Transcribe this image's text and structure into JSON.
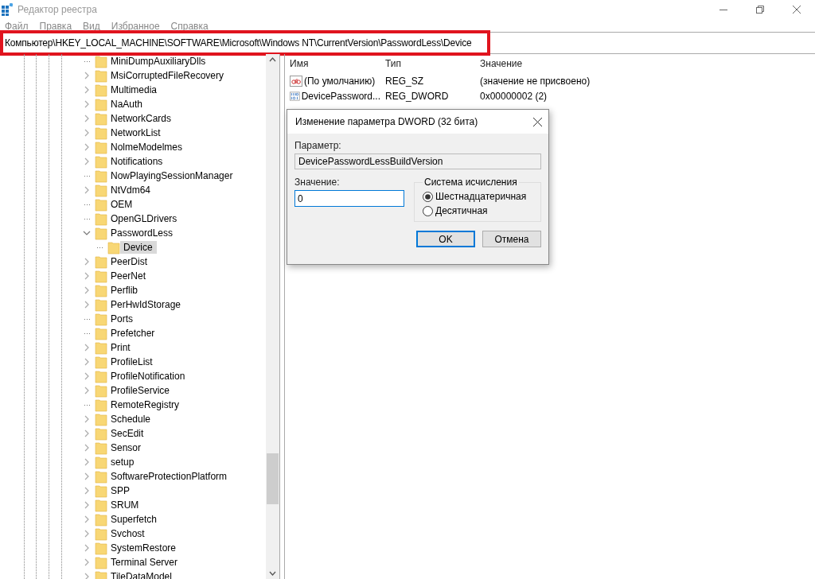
{
  "window": {
    "title": "Редактор реестра"
  },
  "menu": [
    "Файл",
    "Правка",
    "Вид",
    "Избранное",
    "Справка"
  ],
  "address_bar": {
    "value": "Компьютер\\HKEY_LOCAL_MACHINE\\SOFTWARE\\Microsoft\\Windows NT\\CurrentVersion\\PasswordLess\\Device",
    "highlighted": true
  },
  "tree": {
    "items": [
      {
        "label": "MiniDumpAuxiliaryDlls",
        "kind": "leaf",
        "selected": false
      },
      {
        "label": "MsiCorruptedFileRecovery",
        "kind": "folder",
        "expanded": false,
        "selected": false
      },
      {
        "label": "Multimedia",
        "kind": "folder",
        "expanded": false,
        "selected": false
      },
      {
        "label": "NaAuth",
        "kind": "folder",
        "expanded": false,
        "selected": false
      },
      {
        "label": "NetworkCards",
        "kind": "folder",
        "expanded": false,
        "selected": false
      },
      {
        "label": "NetworkList",
        "kind": "folder",
        "expanded": false,
        "selected": false
      },
      {
        "label": "NolmeModelmes",
        "kind": "folder",
        "expanded": false,
        "selected": false
      },
      {
        "label": "Notifications",
        "kind": "folder",
        "expanded": false,
        "selected": false
      },
      {
        "label": "NowPlayingSessionManager",
        "kind": "leaf",
        "selected": false
      },
      {
        "label": "NtVdm64",
        "kind": "folder",
        "expanded": false,
        "selected": false
      },
      {
        "label": "OEM",
        "kind": "leaf",
        "selected": false
      },
      {
        "label": "OpenGLDrivers",
        "kind": "leaf",
        "selected": false
      },
      {
        "label": "PasswordLess",
        "kind": "folder",
        "expanded": true,
        "selected": false,
        "children": [
          {
            "label": "Device",
            "kind": "leaf",
            "selected": true
          }
        ]
      },
      {
        "label": "PeerDist",
        "kind": "folder",
        "expanded": false,
        "selected": false
      },
      {
        "label": "PeerNet",
        "kind": "folder",
        "expanded": false,
        "selected": false
      },
      {
        "label": "Perflib",
        "kind": "folder",
        "expanded": false,
        "selected": false
      },
      {
        "label": "PerHwIdStorage",
        "kind": "folder",
        "expanded": false,
        "selected": false
      },
      {
        "label": "Ports",
        "kind": "leaf",
        "selected": false
      },
      {
        "label": "Prefetcher",
        "kind": "leaf",
        "selected": false
      },
      {
        "label": "Print",
        "kind": "folder",
        "expanded": false,
        "selected": false
      },
      {
        "label": "ProfileList",
        "kind": "folder",
        "expanded": false,
        "selected": false
      },
      {
        "label": "ProfileNotification",
        "kind": "folder",
        "expanded": false,
        "selected": false
      },
      {
        "label": "ProfileService",
        "kind": "folder",
        "expanded": false,
        "selected": false
      },
      {
        "label": "RemoteRegistry",
        "kind": "leaf",
        "selected": false
      },
      {
        "label": "Schedule",
        "kind": "folder",
        "expanded": false,
        "selected": false
      },
      {
        "label": "SecEdit",
        "kind": "folder",
        "expanded": false,
        "selected": false
      },
      {
        "label": "Sensor",
        "kind": "folder",
        "expanded": false,
        "selected": false
      },
      {
        "label": "setup",
        "kind": "folder",
        "expanded": false,
        "selected": false
      },
      {
        "label": "SoftwareProtectionPlatform",
        "kind": "folder",
        "expanded": false,
        "selected": false
      },
      {
        "label": "SPP",
        "kind": "folder",
        "expanded": false,
        "selected": false
      },
      {
        "label": "SRUM",
        "kind": "folder",
        "expanded": false,
        "selected": false
      },
      {
        "label": "Superfetch",
        "kind": "folder",
        "expanded": false,
        "selected": false
      },
      {
        "label": "Svchost",
        "kind": "folder",
        "expanded": false,
        "selected": false
      },
      {
        "label": "SystemRestore",
        "kind": "folder",
        "expanded": false,
        "selected": false
      },
      {
        "label": "Terminal Server",
        "kind": "folder",
        "expanded": false,
        "selected": false
      },
      {
        "label": "TileDataModel",
        "kind": "folder",
        "expanded": false,
        "selected": false
      }
    ]
  },
  "values": {
    "columns": [
      "Имя",
      "Тип",
      "Значение"
    ],
    "rows": [
      {
        "kind": "string",
        "name": "(По умолчанию)",
        "type": "REG_SZ",
        "data": "(значение не присвоено)"
      },
      {
        "kind": "binary",
        "name": "DevicePassword...",
        "type": "REG_DWORD",
        "data": "0x00000002 (2)"
      }
    ]
  },
  "dialog": {
    "title": "Изменение параметра DWORD (32 бита)",
    "param_label": "Параметр:",
    "param_value": "DevicePasswordLessBuildVersion",
    "value_label": "Значение:",
    "value": "0",
    "base_group": "Система исчисления",
    "bases": [
      {
        "label": "Шестнадцатеричная",
        "selected": true
      },
      {
        "label": "Десятичная",
        "selected": false
      }
    ],
    "ok": "OK",
    "cancel": "Отмена"
  }
}
